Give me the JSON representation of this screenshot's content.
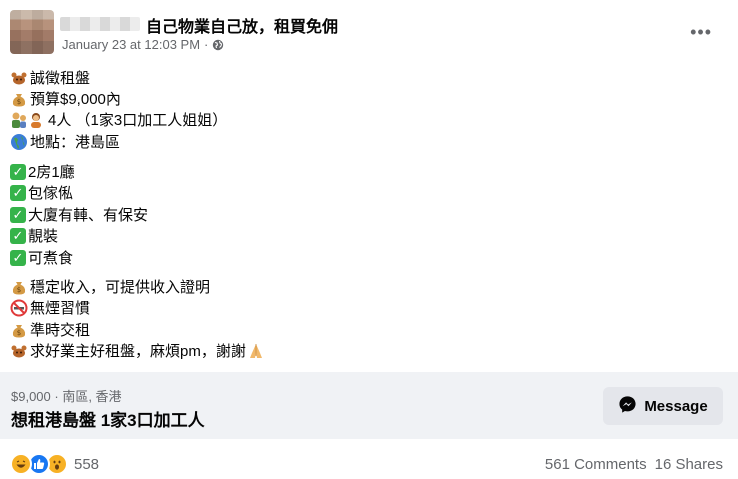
{
  "header": {
    "group_name": "自己物業自己放，租買免佣",
    "timestamp": "January 23 at 12:03 PM",
    "separator": "·",
    "more": "•••"
  },
  "post": {
    "lines": [
      {
        "icon": "squirrel-icon",
        "text": "誠徵租盤"
      },
      {
        "icon": "money-bag-icon",
        "text": "預算$9,000內"
      },
      {
        "icon": "family-icon",
        "text": "4人 （1家3口加工人姐姐）"
      },
      {
        "icon": "globe-icon",
        "text": "地點：港島區"
      },
      {
        "icon": "check-icon",
        "text": "2房1廳"
      },
      {
        "icon": "check-icon",
        "text": "包傢俬"
      },
      {
        "icon": "check-icon",
        "text": "大廈有䡛、有保安"
      },
      {
        "icon": "check-icon",
        "text": "靚裝"
      },
      {
        "icon": "check-icon",
        "text": "可煮食"
      },
      {
        "icon": "money-bag-icon",
        "text": "穩定收入，可提供收入證明"
      },
      {
        "icon": "no-smoking-icon",
        "text": "無煙習慣"
      },
      {
        "icon": "money-bag-icon",
        "text": "準時交租"
      },
      {
        "icon": "squirrel-icon",
        "text": "求好業主好租盤，麻煩pm，謝謝"
      }
    ]
  },
  "listing": {
    "meta": "$9,000 · 南區, 香港",
    "title": "想租港島盤 1家3口加工人",
    "message_label": "Message"
  },
  "footer": {
    "reaction_count": "558",
    "comments": "561 Comments",
    "shares": "16 Shares"
  },
  "colors": {
    "text": "#050505",
    "secondary": "#65676b",
    "listing_bg": "#f0f2f5",
    "button_bg": "#e4e6eb",
    "check_green": "#35b34a",
    "like_blue": "#1877f2",
    "haha_yellow": "#f7b125"
  }
}
